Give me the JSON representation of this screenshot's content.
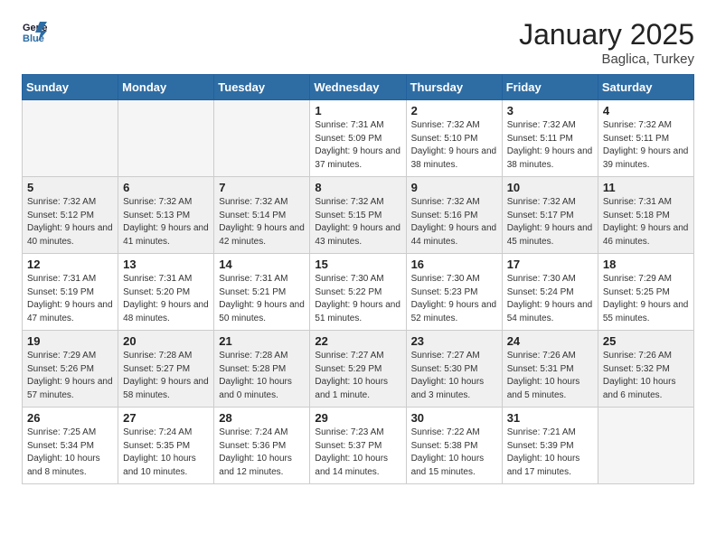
{
  "header": {
    "logo_line1": "General",
    "logo_line2": "Blue",
    "month": "January 2025",
    "location": "Baglica, Turkey"
  },
  "weekdays": [
    "Sunday",
    "Monday",
    "Tuesday",
    "Wednesday",
    "Thursday",
    "Friday",
    "Saturday"
  ],
  "weeks": [
    [
      {
        "day": "",
        "detail": ""
      },
      {
        "day": "",
        "detail": ""
      },
      {
        "day": "",
        "detail": ""
      },
      {
        "day": "1",
        "detail": "Sunrise: 7:31 AM\nSunset: 5:09 PM\nDaylight: 9 hours\nand 37 minutes."
      },
      {
        "day": "2",
        "detail": "Sunrise: 7:32 AM\nSunset: 5:10 PM\nDaylight: 9 hours\nand 38 minutes."
      },
      {
        "day": "3",
        "detail": "Sunrise: 7:32 AM\nSunset: 5:11 PM\nDaylight: 9 hours\nand 38 minutes."
      },
      {
        "day": "4",
        "detail": "Sunrise: 7:32 AM\nSunset: 5:11 PM\nDaylight: 9 hours\nand 39 minutes."
      }
    ],
    [
      {
        "day": "5",
        "detail": "Sunrise: 7:32 AM\nSunset: 5:12 PM\nDaylight: 9 hours\nand 40 minutes."
      },
      {
        "day": "6",
        "detail": "Sunrise: 7:32 AM\nSunset: 5:13 PM\nDaylight: 9 hours\nand 41 minutes."
      },
      {
        "day": "7",
        "detail": "Sunrise: 7:32 AM\nSunset: 5:14 PM\nDaylight: 9 hours\nand 42 minutes."
      },
      {
        "day": "8",
        "detail": "Sunrise: 7:32 AM\nSunset: 5:15 PM\nDaylight: 9 hours\nand 43 minutes."
      },
      {
        "day": "9",
        "detail": "Sunrise: 7:32 AM\nSunset: 5:16 PM\nDaylight: 9 hours\nand 44 minutes."
      },
      {
        "day": "10",
        "detail": "Sunrise: 7:32 AM\nSunset: 5:17 PM\nDaylight: 9 hours\nand 45 minutes."
      },
      {
        "day": "11",
        "detail": "Sunrise: 7:31 AM\nSunset: 5:18 PM\nDaylight: 9 hours\nand 46 minutes."
      }
    ],
    [
      {
        "day": "12",
        "detail": "Sunrise: 7:31 AM\nSunset: 5:19 PM\nDaylight: 9 hours\nand 47 minutes."
      },
      {
        "day": "13",
        "detail": "Sunrise: 7:31 AM\nSunset: 5:20 PM\nDaylight: 9 hours\nand 48 minutes."
      },
      {
        "day": "14",
        "detail": "Sunrise: 7:31 AM\nSunset: 5:21 PM\nDaylight: 9 hours\nand 50 minutes."
      },
      {
        "day": "15",
        "detail": "Sunrise: 7:30 AM\nSunset: 5:22 PM\nDaylight: 9 hours\nand 51 minutes."
      },
      {
        "day": "16",
        "detail": "Sunrise: 7:30 AM\nSunset: 5:23 PM\nDaylight: 9 hours\nand 52 minutes."
      },
      {
        "day": "17",
        "detail": "Sunrise: 7:30 AM\nSunset: 5:24 PM\nDaylight: 9 hours\nand 54 minutes."
      },
      {
        "day": "18",
        "detail": "Sunrise: 7:29 AM\nSunset: 5:25 PM\nDaylight: 9 hours\nand 55 minutes."
      }
    ],
    [
      {
        "day": "19",
        "detail": "Sunrise: 7:29 AM\nSunset: 5:26 PM\nDaylight: 9 hours\nand 57 minutes."
      },
      {
        "day": "20",
        "detail": "Sunrise: 7:28 AM\nSunset: 5:27 PM\nDaylight: 9 hours\nand 58 minutes."
      },
      {
        "day": "21",
        "detail": "Sunrise: 7:28 AM\nSunset: 5:28 PM\nDaylight: 10 hours\nand 0 minutes."
      },
      {
        "day": "22",
        "detail": "Sunrise: 7:27 AM\nSunset: 5:29 PM\nDaylight: 10 hours\nand 1 minute."
      },
      {
        "day": "23",
        "detail": "Sunrise: 7:27 AM\nSunset: 5:30 PM\nDaylight: 10 hours\nand 3 minutes."
      },
      {
        "day": "24",
        "detail": "Sunrise: 7:26 AM\nSunset: 5:31 PM\nDaylight: 10 hours\nand 5 minutes."
      },
      {
        "day": "25",
        "detail": "Sunrise: 7:26 AM\nSunset: 5:32 PM\nDaylight: 10 hours\nand 6 minutes."
      }
    ],
    [
      {
        "day": "26",
        "detail": "Sunrise: 7:25 AM\nSunset: 5:34 PM\nDaylight: 10 hours\nand 8 minutes."
      },
      {
        "day": "27",
        "detail": "Sunrise: 7:24 AM\nSunset: 5:35 PM\nDaylight: 10 hours\nand 10 minutes."
      },
      {
        "day": "28",
        "detail": "Sunrise: 7:24 AM\nSunset: 5:36 PM\nDaylight: 10 hours\nand 12 minutes."
      },
      {
        "day": "29",
        "detail": "Sunrise: 7:23 AM\nSunset: 5:37 PM\nDaylight: 10 hours\nand 14 minutes."
      },
      {
        "day": "30",
        "detail": "Sunrise: 7:22 AM\nSunset: 5:38 PM\nDaylight: 10 hours\nand 15 minutes."
      },
      {
        "day": "31",
        "detail": "Sunrise: 7:21 AM\nSunset: 5:39 PM\nDaylight: 10 hours\nand 17 minutes."
      },
      {
        "day": "",
        "detail": ""
      }
    ]
  ]
}
